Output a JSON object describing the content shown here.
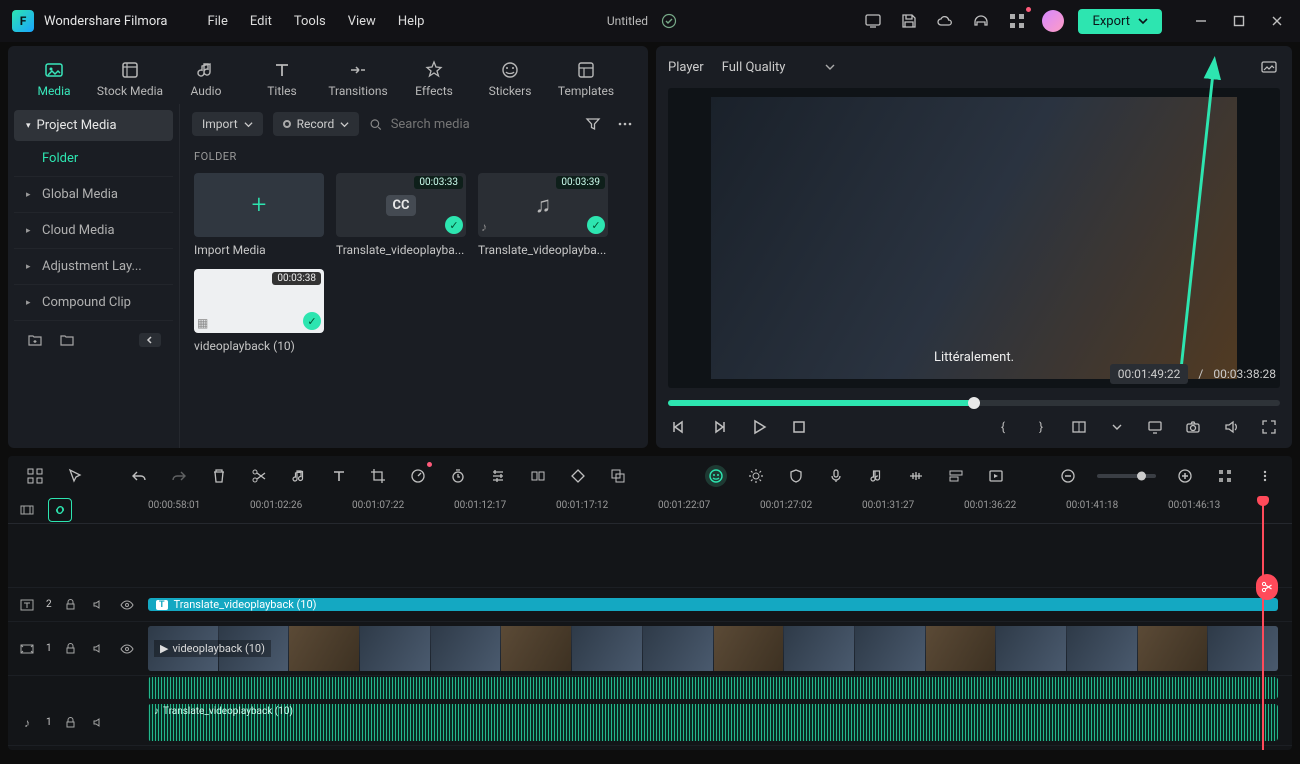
{
  "app": {
    "name": "Wondershare Filmora",
    "doc_title": "Untitled"
  },
  "menu": {
    "file": "File",
    "edit": "Edit",
    "tools": "Tools",
    "view": "View",
    "help": "Help"
  },
  "export": {
    "label": "Export"
  },
  "lib_tabs": {
    "media": "Media",
    "stock": "Stock Media",
    "audio": "Audio",
    "titles": "Titles",
    "transitions": "Transitions",
    "effects": "Effects",
    "stickers": "Stickers",
    "templates": "Templates"
  },
  "sidebar": {
    "project_media": "Project Media",
    "folder": "Folder",
    "global_media": "Global Media",
    "cloud_media": "Cloud Media",
    "adjustment": "Adjustment Lay...",
    "compound": "Compound Clip"
  },
  "toolbar": {
    "import": "Import",
    "record": "Record",
    "search_placeholder": "Search media"
  },
  "folder_label": "FOLDER",
  "media": {
    "import_label": "Import Media",
    "items": [
      {
        "duration": "00:03:33",
        "label": "Translate_videoplayba..."
      },
      {
        "duration": "00:03:39",
        "label": "Translate_videoplayba..."
      },
      {
        "duration": "00:03:38",
        "label": "videoplayback (10)"
      }
    ]
  },
  "player": {
    "tab": "Player",
    "quality": "Full Quality",
    "caption": "Littéralement.",
    "current": "00:01:49:22",
    "sep": "/",
    "total": "00:03:38:28"
  },
  "ruler": {
    "t0": "00:00:58:01",
    "t1": "00:01:02:26",
    "t2": "00:01:07:22",
    "t3": "00:01:12:17",
    "t4": "00:01:17:12",
    "t5": "00:01:22:07",
    "t6": "00:01:27:02",
    "t7": "00:01:31:27",
    "t8": "00:01:36:22",
    "t9": "00:01:41:18",
    "t10": "00:01:46:13"
  },
  "tracks": {
    "t2_idx": "2",
    "t1_idx": "1",
    "a1_idx": "1",
    "subtitle_clip": "Translate_videoplayback (10)",
    "video_clip": "videoplayback (10)",
    "audio_clip": "Translate_videoplayback (10)"
  }
}
